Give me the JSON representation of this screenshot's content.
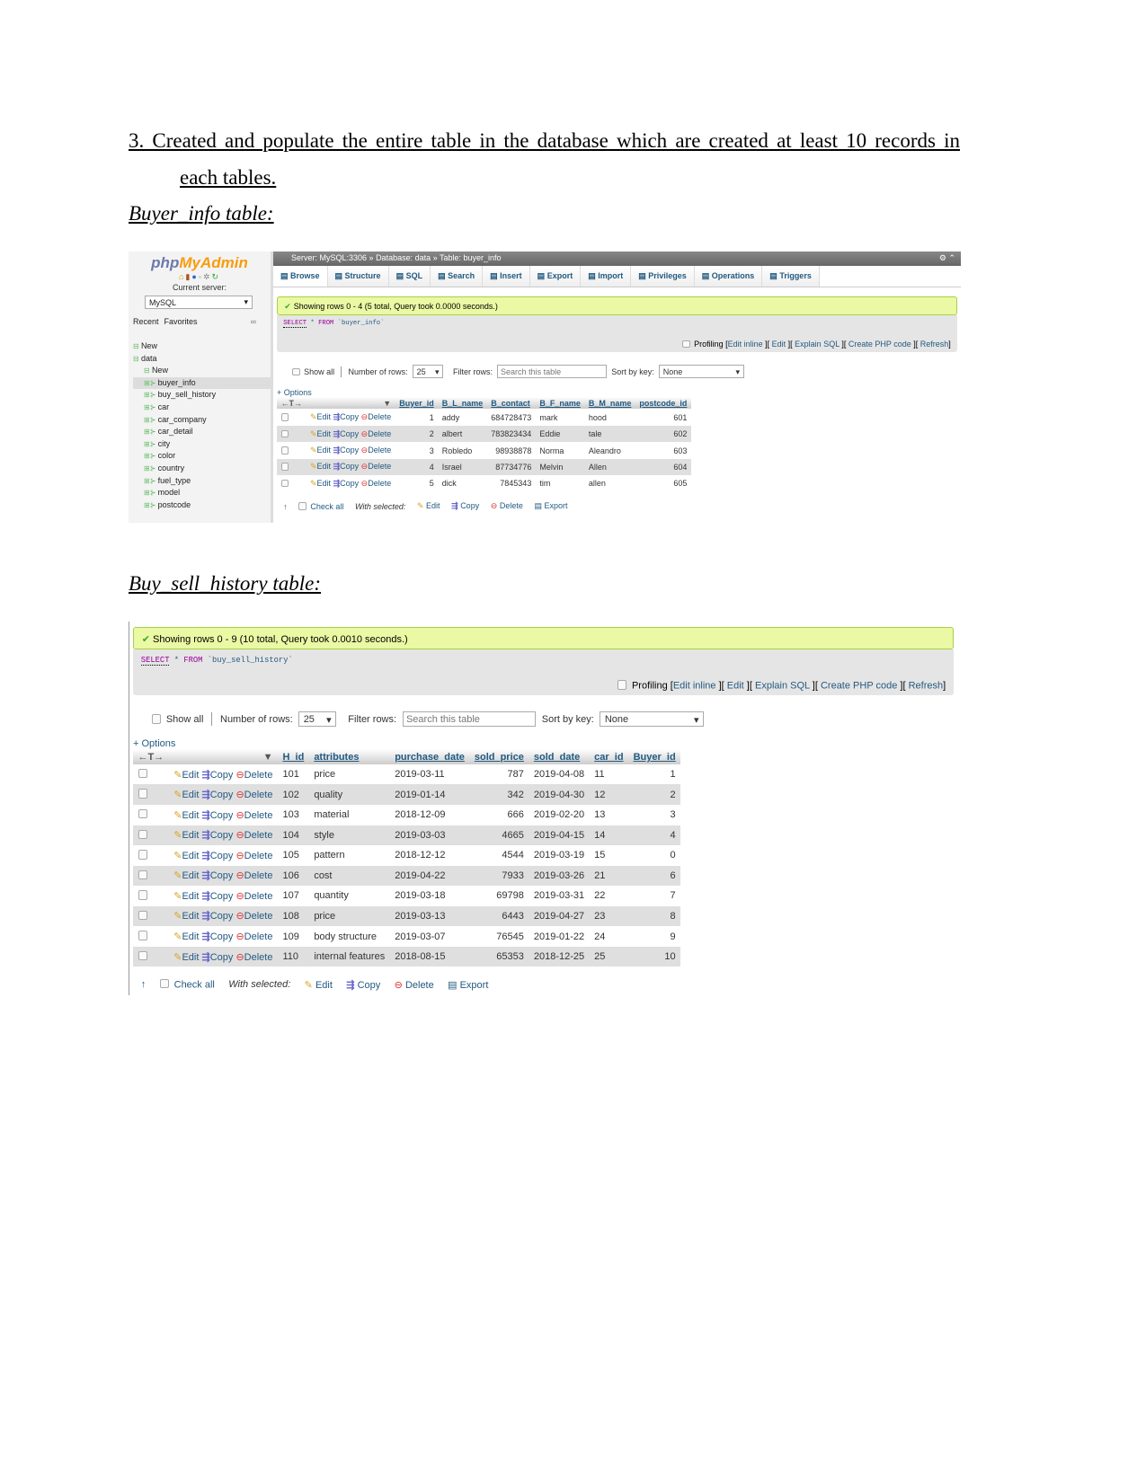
{
  "doc": {
    "heading_line1": "3. Created and populate the entire table in the database which are created at least 10 records in",
    "heading_line2": "each tables.",
    "section1_title": "Buyer_info table:",
    "section2_title": "Buy_sell_history table:"
  },
  "panel1": {
    "sidebar": {
      "logo_part1": "php",
      "logo_part2": "MyAdmin",
      "current_server_label": "Current server:",
      "server_select": "MySQL",
      "recent": "Recent",
      "favorites": "Favorites",
      "tree": [
        {
          "label": "New",
          "level": 0
        },
        {
          "label": "data",
          "level": 0
        },
        {
          "label": "New",
          "level": 1
        },
        {
          "label": "buyer_info",
          "level": 1,
          "selected": true
        },
        {
          "label": "buy_sell_history",
          "level": 1
        },
        {
          "label": "car",
          "level": 1
        },
        {
          "label": "car_company",
          "level": 1
        },
        {
          "label": "car_detail",
          "level": 1
        },
        {
          "label": "city",
          "level": 1
        },
        {
          "label": "color",
          "level": 1
        },
        {
          "label": "country",
          "level": 1
        },
        {
          "label": "fuel_type",
          "level": 1
        },
        {
          "label": "model",
          "level": 1
        },
        {
          "label": "postcode",
          "level": 1
        }
      ]
    },
    "topbar": {
      "breadcrumb": [
        "Server: MySQL:3306",
        "Database: data",
        "Table: buyer_info"
      ]
    },
    "tabs": [
      "Browse",
      "Structure",
      "SQL",
      "Search",
      "Insert",
      "Export",
      "Import",
      "Privileges",
      "Operations",
      "Triggers"
    ],
    "result": {
      "success": "Showing rows 0 - 4 (5 total, Query took 0.0000 seconds.)",
      "sql": {
        "select": "SELECT",
        "star": "*",
        "from": "FROM",
        "table": "`buyer_info`"
      },
      "profiling": "Profiling",
      "links": [
        "Edit inline",
        "Edit",
        "Explain SQL",
        "Create PHP code",
        "Refresh"
      ]
    },
    "controls": {
      "show_all": "Show all",
      "num_rows_label": "Number of rows:",
      "num_rows": "25",
      "filter_label": "Filter rows:",
      "filter_placeholder": "Search this table",
      "sort_label": "Sort by key:",
      "sort_value": "None"
    },
    "options": "+ Options",
    "row_actions": {
      "edit": "Edit",
      "copy": "Copy",
      "delete": "Delete"
    },
    "table": {
      "columns": [
        "Buyer_id",
        "B_L_name",
        "B_contact",
        "B_F_name",
        "B_M_name",
        "postcode_id"
      ],
      "numeric": [
        true,
        false,
        true,
        false,
        false,
        true
      ],
      "rows": [
        [
          "1",
          "addy",
          "684728473",
          "mark",
          "hood",
          "601"
        ],
        [
          "2",
          "albert",
          "783823434",
          "Eddie",
          "tale",
          "602"
        ],
        [
          "3",
          "Robledo",
          "98938878",
          "Norma",
          "Aleandro",
          "603"
        ],
        [
          "4",
          "Israel",
          "87734776",
          "Melvin",
          "Allen",
          "604"
        ],
        [
          "5",
          "dick",
          "7845343",
          "tim",
          "allen",
          "605"
        ]
      ]
    },
    "footer": {
      "check_all": "Check all",
      "with_selected": "With selected:",
      "edit": "Edit",
      "copy": "Copy",
      "delete": "Delete",
      "export": "Export"
    }
  },
  "panel2": {
    "result": {
      "success": "Showing rows 0 - 9 (10 total, Query took 0.0010 seconds.)",
      "sql": {
        "select": "SELECT",
        "star": "*",
        "from": "FROM",
        "table": "`buy_sell_history`"
      },
      "profiling": "Profiling",
      "links": [
        "Edit inline",
        "Edit",
        "Explain SQL",
        "Create PHP code",
        "Refresh"
      ]
    },
    "controls": {
      "show_all": "Show all",
      "num_rows_label": "Number of rows:",
      "num_rows": "25",
      "filter_label": "Filter rows:",
      "filter_placeholder": "Search this table",
      "sort_label": "Sort by key:",
      "sort_value": "None"
    },
    "options": "+ Options",
    "row_actions": {
      "edit": "Edit",
      "copy": "Copy",
      "delete": "Delete"
    },
    "table": {
      "columns": [
        "H_id",
        "attributes",
        "purchase_date",
        "sold_price",
        "sold_date",
        "car_id",
        "Buyer_id"
      ],
      "numeric": [
        false,
        false,
        false,
        true,
        false,
        false,
        true
      ],
      "rows": [
        [
          "101",
          "price",
          "2019-03-11",
          "787",
          "2019-04-08",
          "11",
          "1"
        ],
        [
          "102",
          "quality",
          "2019-01-14",
          "342",
          "2019-04-30",
          "12",
          "2"
        ],
        [
          "103",
          "material",
          "2018-12-09",
          "666",
          "2019-02-20",
          "13",
          "3"
        ],
        [
          "104",
          "style",
          "2019-03-03",
          "4665",
          "2019-04-15",
          "14",
          "4"
        ],
        [
          "105",
          "pattern",
          "2018-12-12",
          "4544",
          "2019-03-19",
          "15",
          "0"
        ],
        [
          "106",
          "cost",
          "2019-04-22",
          "7933",
          "2019-03-26",
          "21",
          "6"
        ],
        [
          "107",
          "quantity",
          "2019-03-18",
          "69798",
          "2019-03-31",
          "22",
          "7"
        ],
        [
          "108",
          "price",
          "2019-03-13",
          "6443",
          "2019-04-27",
          "23",
          "8"
        ],
        [
          "109",
          "body structure",
          "2019-03-07",
          "76545",
          "2019-01-22",
          "24",
          "9"
        ],
        [
          "110",
          "internal features",
          "2018-08-15",
          "65353",
          "2018-12-25",
          "25",
          "10"
        ]
      ]
    },
    "footer": {
      "check_all": "Check all",
      "with_selected": "With selected:",
      "edit": "Edit",
      "copy": "Copy",
      "delete": "Delete",
      "export": "Export"
    }
  },
  "colors": {
    "success_bg": "#ebf8a4",
    "link": "#235a81",
    "row_alt": "#dfdfdf",
    "logo_php": "#6c78af",
    "logo_myadmin": "#f89c0e"
  }
}
